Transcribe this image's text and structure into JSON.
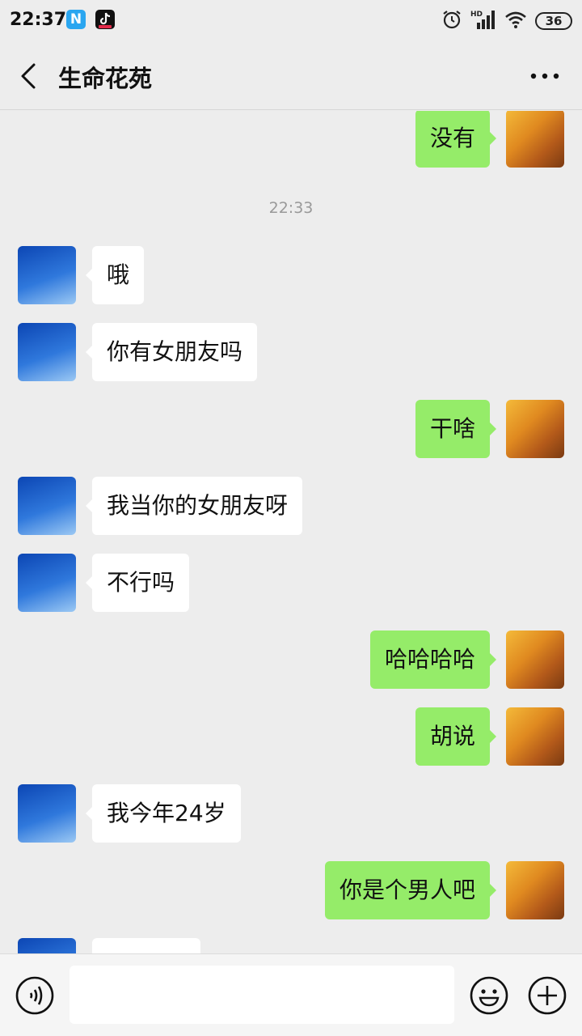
{
  "status_bar": {
    "time": "22:37",
    "app_icon_n": "N",
    "signal_tag": "HD",
    "battery": "36"
  },
  "header": {
    "title": "生命花苑"
  },
  "chat": {
    "messages": [
      {
        "side": "right",
        "text": "没有"
      },
      {
        "side": "left",
        "text": "哦"
      },
      {
        "side": "left",
        "text": "你有女朋友吗"
      },
      {
        "side": "right",
        "text": "干啥"
      },
      {
        "side": "left",
        "text": "我当你的女朋友呀"
      },
      {
        "side": "left",
        "text": "不行吗"
      },
      {
        "side": "right",
        "text": "哈哈哈哈"
      },
      {
        "side": "right",
        "text": "胡说"
      },
      {
        "side": "left",
        "text": "我今年24岁"
      },
      {
        "side": "right",
        "text": "你是个男人吧"
      },
      {
        "side": "left",
        "text": ""
      }
    ],
    "timestamp": "22:33"
  },
  "input_bar": {
    "placeholder": "",
    "value": ""
  },
  "icons": {
    "back": "back-arrow-icon",
    "more": "more-dots-icon",
    "voice": "voice-icon",
    "emoji": "emoji-icon",
    "plus": "plus-icon",
    "alarm": "alarm-icon",
    "signal": "signal-icon",
    "wifi": "wifi-icon"
  },
  "colors": {
    "background": "#ededed",
    "bubble_out": "#95ec69",
    "bubble_in": "#ffffff",
    "timestamp": "#999999"
  }
}
